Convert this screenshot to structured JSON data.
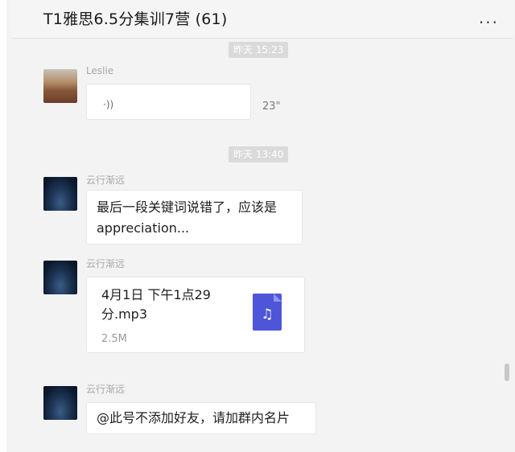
{
  "header": {
    "title": "T1雅思6.5分集训7营 (61)",
    "more_label": "..."
  },
  "messages": [
    {
      "type": "time",
      "text": "昨天 15:23"
    },
    {
      "type": "voice",
      "sender": "Leslie",
      "voice_symbol": "·))",
      "duration": "23\""
    },
    {
      "type": "time",
      "text": "昨天 13:40"
    },
    {
      "type": "text",
      "sender": "云行渐远",
      "text_line1": "最后一段关键词说错了，应该是",
      "text_line2": "appreciation..."
    },
    {
      "type": "file",
      "sender": "云行渐远",
      "file_name": "4月1日 下午1点29分.mp3",
      "file_size": "2.5M",
      "file_icon": "music-note-icon",
      "file_icon_color": "#4f55d9",
      "file_icon_glyph": "♫"
    },
    {
      "type": "text",
      "sender": "云行渐远",
      "text": "@此号不添加好友，请加群内名片"
    }
  ]
}
